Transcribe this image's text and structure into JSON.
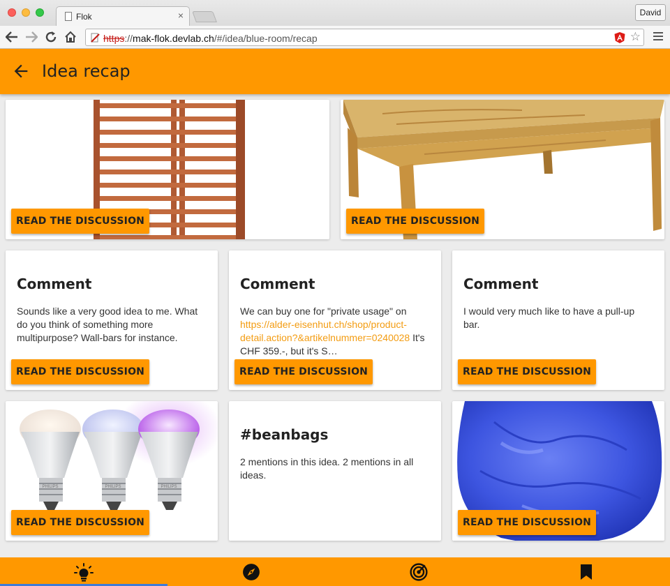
{
  "browser": {
    "tab_title": "Flok",
    "tab_close": "×",
    "profile_name": "David",
    "url_protocol": "https",
    "url_separator": "://",
    "url_host": "mak-flok.devlab.ch",
    "url_path": "/#/idea/blue-room/recap"
  },
  "appbar": {
    "title": "Idea recap",
    "back_icon": "arrow-back-icon"
  },
  "cards": {
    "wallbars": {
      "image": "wall-bars-photo",
      "button": "READ THE DISCUSSION"
    },
    "table": {
      "image": "wooden-table-photo",
      "button": "READ THE DISCUSSION"
    },
    "comment1": {
      "title": "Comment",
      "text": "Sounds like a very good idea to me. What do you think of something more multipurpose? Wall-bars for instance.",
      "button": "READ THE DISCUSSION"
    },
    "comment2": {
      "title": "Comment",
      "text_before": "We can buy one for \"private usage\" on ",
      "link": "https://alder-eisenhut.ch/shop/product-detail.action?&artikelnummer=0240028",
      "text_after": " It's CHF 359.-, but it's S…",
      "button": "READ THE DISCUSSION"
    },
    "comment3": {
      "title": "Comment",
      "text": "I would very much like to have a pull-up bar.",
      "button": "READ THE DISCUSSION"
    },
    "bulbs": {
      "image": "smart-bulbs-photo",
      "brand": "PHILIPS",
      "button": "READ THE DISCUSSION"
    },
    "hashtag": {
      "title": "#beanbags",
      "text": "2 mentions in this idea. 2 mentions in all ideas."
    },
    "beanbag": {
      "image": "blue-beanbag-photo",
      "button": "READ THE DISCUSSION"
    }
  },
  "bottom_nav": {
    "items": [
      "lightbulb-icon",
      "compass-icon",
      "radar-icon",
      "bookmark-icon"
    ],
    "active_index": 0
  },
  "colors": {
    "accent": "#ff9800",
    "link": "#f39c12",
    "active_indicator": "#3f7bd8",
    "beanbag": "#3d55e0"
  }
}
